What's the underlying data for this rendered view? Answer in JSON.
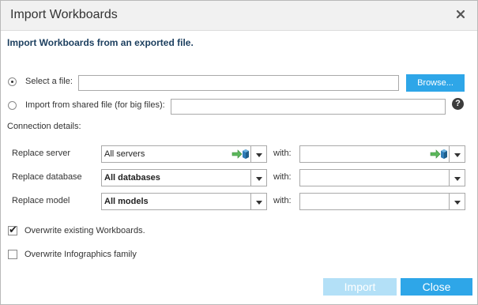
{
  "dialog": {
    "title": "Import Workboards",
    "close_icon": "close-icon",
    "subtitle": "Import Workboards from an exported file."
  },
  "source": {
    "select_file_label": "Select a file:",
    "select_file_selected": true,
    "select_file_value": "",
    "browse_label": "Browse...",
    "shared_file_label": "Import from shared file (for big files):",
    "shared_file_selected": false,
    "shared_file_value": "",
    "help_glyph": "?"
  },
  "connection": {
    "heading": "Connection details:",
    "with_label": "with:",
    "rows": [
      {
        "label": "Replace server",
        "value": "All servers",
        "with_value": ""
      },
      {
        "label": "Replace database",
        "value": "All databases",
        "with_value": ""
      },
      {
        "label": "Replace model",
        "value": "All models",
        "with_value": ""
      }
    ]
  },
  "options": {
    "overwrite_workboards_label": "Overwrite existing Workboards.",
    "overwrite_workboards_checked": true,
    "overwrite_infographics_label": "Overwrite Infographics family",
    "overwrite_infographics_checked": false,
    "check_glyph": "✔"
  },
  "footer": {
    "import_label": "Import",
    "close_label": "Close"
  },
  "colors": {
    "accent": "#2ea6e8",
    "accent_disabled": "#b3e0f7",
    "subtitle": "#1c3f5f"
  }
}
